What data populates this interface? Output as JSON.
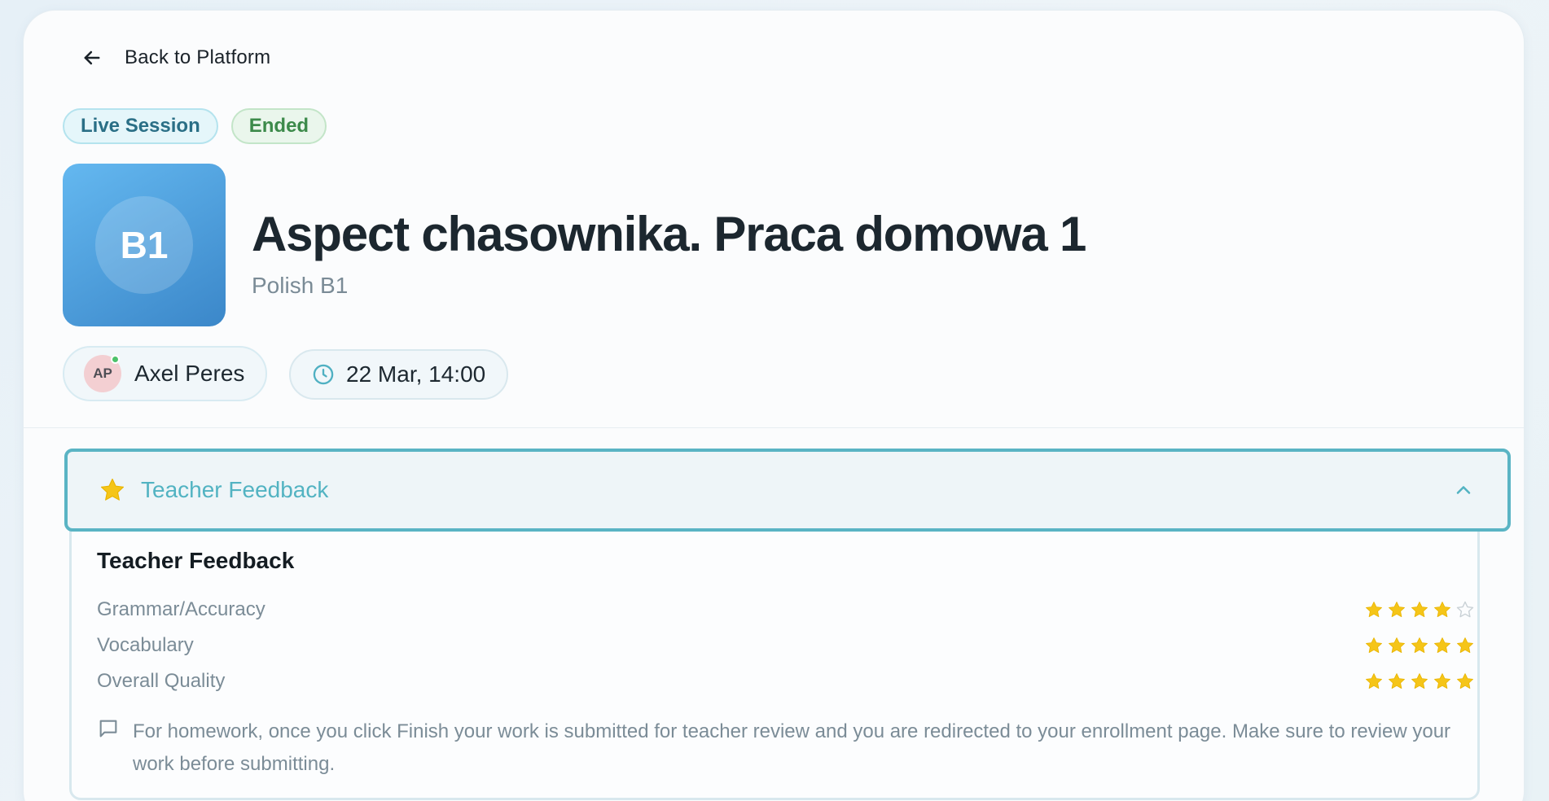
{
  "nav": {
    "back_label": "Back to Platform"
  },
  "badges": {
    "session_type": "Live Session",
    "status": "Ended"
  },
  "course": {
    "level": "B1",
    "title": "Aspect chasownika. Praca domowa 1",
    "subtitle": "Polish B1"
  },
  "teacher": {
    "initials": "AP",
    "name": "Axel Peres",
    "online": true
  },
  "schedule": {
    "datetime": "22 Mar, 14:00"
  },
  "feedback": {
    "header_label": "Teacher Feedback",
    "expanded": true,
    "title": "Teacher Feedback",
    "ratings": [
      {
        "label": "Grammar/Accuracy",
        "stars": 4,
        "max": 5
      },
      {
        "label": "Vocabulary",
        "stars": 5,
        "max": 5
      },
      {
        "label": "Overall Quality",
        "stars": 5,
        "max": 5
      }
    ],
    "comment": "For homework, once you click Finish your work is submitted for teacher review and you are redirected to your enrollment page. Make sure to review your work before submitting."
  },
  "colors": {
    "accent": "#5ab4c4",
    "star": "#f5c518",
    "star_empty": "#c9d1d6",
    "live_badge": "#2a6f86",
    "ended_badge": "#3c8a4a",
    "tile_gradient_start": "#64b8f0",
    "tile_gradient_end": "#3b87c9"
  },
  "icons": {
    "back": "arrow-left-icon",
    "time": "clock-icon",
    "feedback_header": "star-icon",
    "collapse": "chevron-up-icon",
    "comment": "message-square-icon"
  }
}
